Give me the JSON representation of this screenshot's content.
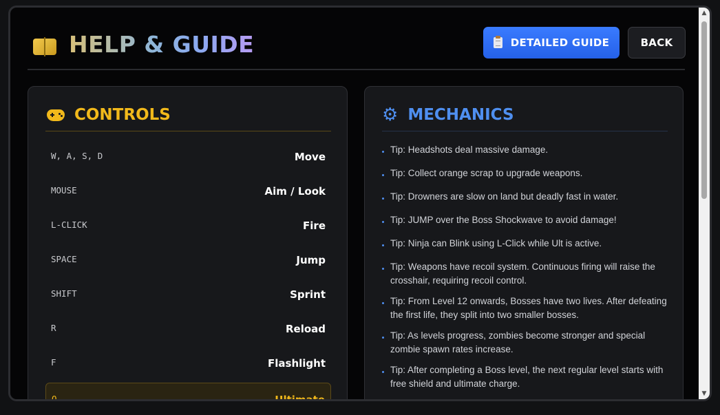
{
  "header": {
    "title": "HELP & GUIDE",
    "guide_label": "DETAILED GUIDE",
    "back_label": "BACK",
    "icons": {
      "title": "book-icon",
      "guide": "clipboard-icon"
    }
  },
  "controls": {
    "title": "CONTROLS",
    "icon": "gamepad-icon",
    "accent": "#f2b91b",
    "rows": [
      {
        "key": "W, A, S, D",
        "action": "Move"
      },
      {
        "key": "MOUSE",
        "action": "Aim / Look"
      },
      {
        "key": "L-CLICK",
        "action": "Fire"
      },
      {
        "key": "SPACE",
        "action": "Jump"
      },
      {
        "key": "SHIFT",
        "action": "Sprint"
      },
      {
        "key": "R",
        "action": "Reload"
      },
      {
        "key": "F",
        "action": "Flashlight"
      },
      {
        "key": "Q",
        "action": "Ultimate"
      }
    ]
  },
  "mechanics": {
    "title": "MECHANICS",
    "icon": "gear-icon",
    "accent": "#4f8ff0",
    "tips": [
      "Tip: Headshots deal massive damage.",
      "Tip: Collect orange scrap to upgrade weapons.",
      "Tip: Drowners are slow on land but deadly fast in water.",
      "Tip: JUMP over the Boss Shockwave to avoid damage!",
      "Tip: Ninja can Blink using L-Click while Ult is active.",
      "Tip: Weapons have recoil system. Continuous firing will raise the crosshair, requiring recoil control.",
      "Tip: From Level 12 onwards, Bosses have two lives. After defeating the first life, they split into two smaller bosses.",
      "Tip: As levels progress, zombies become stronger and special zombie spawn rates increase.",
      "Tip: After completing a Boss level, the next regular level starts with free shield and ultimate charge."
    ]
  }
}
